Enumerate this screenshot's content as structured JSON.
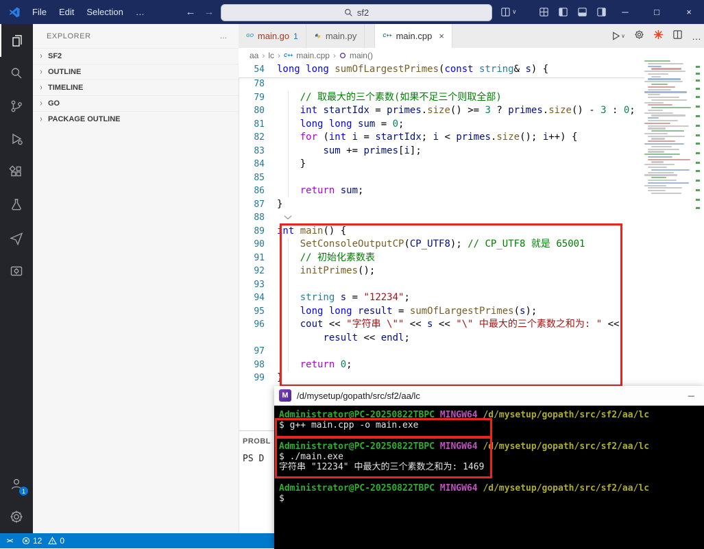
{
  "titlebar": {
    "menus": [
      "File",
      "Edit",
      "Selection",
      "…"
    ],
    "search_value": "sf2"
  },
  "sidebar": {
    "header": "EXPLORER",
    "sections": [
      "SF2",
      "OUTLINE",
      "TIMELINE",
      "GO",
      "PACKAGE OUTLINE"
    ]
  },
  "tabs": [
    {
      "label": "main.go",
      "badge": "1"
    },
    {
      "label": "main.py",
      "badge": ""
    },
    {
      "label": "main.cpp",
      "badge": ""
    }
  ],
  "breadcrumb": [
    "aa",
    "lc",
    "main.cpp",
    "main()"
  ],
  "editor": {
    "sticky": {
      "num": "54",
      "tokens": [
        [
          "kw",
          "long long "
        ],
        [
          "fn",
          "sumOfLargestPrimes"
        ],
        [
          "op",
          "("
        ],
        [
          "kw",
          "const "
        ],
        [
          "type",
          "string"
        ],
        [
          "op",
          "& "
        ],
        [
          "var",
          "s"
        ],
        [
          "op",
          ") {"
        ]
      ]
    },
    "lines": [
      {
        "num": "78",
        "tokens": []
      },
      {
        "num": "79",
        "tokens": [
          [
            "op",
            "    "
          ],
          [
            "cmt",
            "// 取最大的三个素数(如果不足三个则取全部)"
          ]
        ]
      },
      {
        "num": "80",
        "tokens": [
          [
            "op",
            "    "
          ],
          [
            "kw",
            "int "
          ],
          [
            "var",
            "startIdx"
          ],
          [
            "op",
            " = "
          ],
          [
            "var",
            "primes"
          ],
          [
            "op",
            "."
          ],
          [
            "fn",
            "size"
          ],
          [
            "op",
            "() >= "
          ],
          [
            "num",
            "3"
          ],
          [
            "op",
            " ? "
          ],
          [
            "var",
            "primes"
          ],
          [
            "op",
            "."
          ],
          [
            "fn",
            "size"
          ],
          [
            "op",
            "() - "
          ],
          [
            "num",
            "3"
          ],
          [
            "op",
            " : "
          ],
          [
            "num",
            "0"
          ],
          [
            "op",
            ";"
          ]
        ]
      },
      {
        "num": "81",
        "tokens": [
          [
            "op",
            "    "
          ],
          [
            "kw",
            "long long "
          ],
          [
            "var",
            "sum"
          ],
          [
            "op",
            " = "
          ],
          [
            "num",
            "0"
          ],
          [
            "op",
            ";"
          ]
        ]
      },
      {
        "num": "82",
        "tokens": [
          [
            "op",
            "    "
          ],
          [
            "ctrl",
            "for"
          ],
          [
            "op",
            " ("
          ],
          [
            "kw",
            "int "
          ],
          [
            "var",
            "i"
          ],
          [
            "op",
            " = "
          ],
          [
            "var",
            "startIdx"
          ],
          [
            "op",
            "; "
          ],
          [
            "var",
            "i"
          ],
          [
            "op",
            " < "
          ],
          [
            "var",
            "primes"
          ],
          [
            "op",
            "."
          ],
          [
            "fn",
            "size"
          ],
          [
            "op",
            "(); "
          ],
          [
            "var",
            "i"
          ],
          [
            "op",
            "++) {"
          ]
        ]
      },
      {
        "num": "83",
        "tokens": [
          [
            "op",
            "        "
          ],
          [
            "var",
            "sum"
          ],
          [
            "op",
            " += "
          ],
          [
            "var",
            "primes"
          ],
          [
            "op",
            "["
          ],
          [
            "var",
            "i"
          ],
          [
            "op",
            "];"
          ]
        ]
      },
      {
        "num": "84",
        "tokens": [
          [
            "op",
            "    }"
          ]
        ]
      },
      {
        "num": "85",
        "tokens": []
      },
      {
        "num": "86",
        "tokens": [
          [
            "op",
            "    "
          ],
          [
            "ctrl",
            "return"
          ],
          [
            "op",
            " "
          ],
          [
            "var",
            "sum"
          ],
          [
            "op",
            ";"
          ]
        ]
      },
      {
        "num": "87",
        "tokens": [
          [
            "op",
            "}"
          ]
        ]
      },
      {
        "num": "88",
        "tokens": []
      },
      {
        "num": "89",
        "tokens": [
          [
            "kw",
            "int "
          ],
          [
            "fn",
            "main"
          ],
          [
            "op",
            "() {"
          ]
        ]
      },
      {
        "num": "90",
        "tokens": [
          [
            "op",
            "    "
          ],
          [
            "fn",
            "SetConsoleOutputCP"
          ],
          [
            "op",
            "("
          ],
          [
            "var",
            "CP_UTF8"
          ],
          [
            "op",
            "); "
          ],
          [
            "cmt",
            "// CP_UTF8 就是 65001"
          ]
        ]
      },
      {
        "num": "91",
        "tokens": [
          [
            "op",
            "    "
          ],
          [
            "cmt",
            "// 初始化素数表"
          ]
        ]
      },
      {
        "num": "92",
        "tokens": [
          [
            "op",
            "    "
          ],
          [
            "fn",
            "initPrimes"
          ],
          [
            "op",
            "();"
          ]
        ]
      },
      {
        "num": "93",
        "tokens": []
      },
      {
        "num": "94",
        "tokens": [
          [
            "op",
            "    "
          ],
          [
            "type",
            "string"
          ],
          [
            "op",
            " "
          ],
          [
            "var",
            "s"
          ],
          [
            "op",
            " = "
          ],
          [
            "str",
            "\"12234\""
          ],
          [
            "op",
            ";"
          ]
        ]
      },
      {
        "num": "95",
        "tokens": [
          [
            "op",
            "    "
          ],
          [
            "kw",
            "long long "
          ],
          [
            "var",
            "result"
          ],
          [
            "op",
            " = "
          ],
          [
            "fn",
            "sumOfLargestPrimes"
          ],
          [
            "op",
            "("
          ],
          [
            "var",
            "s"
          ],
          [
            "op",
            ");"
          ]
        ]
      },
      {
        "num": "96",
        "tokens": [
          [
            "op",
            "    "
          ],
          [
            "var",
            "cout"
          ],
          [
            "op",
            " << "
          ],
          [
            "str",
            "\"字符串 \\\"\""
          ],
          [
            "op",
            " << "
          ],
          [
            "var",
            "s"
          ],
          [
            "op",
            " << "
          ],
          [
            "str",
            "\"\\\" 中最大的三个素数之和为: \""
          ],
          [
            "op",
            " <<"
          ]
        ]
      },
      {
        "num": "",
        "tokens": [
          [
            "op",
            "        "
          ],
          [
            "var",
            "result"
          ],
          [
            "op",
            " << "
          ],
          [
            "var",
            "endl"
          ],
          [
            "op",
            ";"
          ]
        ]
      },
      {
        "num": "97",
        "tokens": []
      },
      {
        "num": "98",
        "tokens": [
          [
            "op",
            "    "
          ],
          [
            "ctrl",
            "return"
          ],
          [
            "op",
            " "
          ],
          [
            "num",
            "0"
          ],
          [
            "op",
            ";"
          ]
        ]
      },
      {
        "num": "99",
        "tokens": [
          [
            "op",
            "}"
          ]
        ]
      }
    ]
  },
  "panel": {
    "tab": "PROBL",
    "content": "PS D"
  },
  "terminal": {
    "title": "/d/mysetup/gopath/src/sf2/aa/lc",
    "lines": [
      {
        "parts": [
          [
            "green",
            "Administrator@PC-20250822TBPC "
          ],
          [
            "magenta",
            "MINGW64 "
          ],
          [
            "yellow",
            "/d/mysetup/gopath/src/sf2/aa/lc"
          ]
        ]
      },
      {
        "parts": [
          [
            "white",
            "$ g++ main.cpp -o main.exe"
          ]
        ]
      },
      {
        "parts": []
      },
      {
        "parts": [
          [
            "green",
            "Administrator@PC-20250822TBPC "
          ],
          [
            "magenta",
            "MINGW64 "
          ],
          [
            "yellow",
            "/d/mysetup/gopath/src/sf2/aa/lc"
          ]
        ]
      },
      {
        "parts": [
          [
            "white",
            "$ ./main.exe"
          ]
        ]
      },
      {
        "parts": [
          [
            "white",
            "字符串 \"12234\" 中最大的三个素数之和为: 1469"
          ]
        ]
      },
      {
        "parts": []
      },
      {
        "parts": [
          [
            "green",
            "Administrator@PC-20250822TBPC "
          ],
          [
            "magenta",
            "MINGW64 "
          ],
          [
            "yellow",
            "/d/mysetup/gopath/src/sf2/aa/lc"
          ]
        ]
      },
      {
        "parts": [
          [
            "white",
            "$"
          ]
        ]
      }
    ]
  },
  "statusbar": {
    "errors": "12",
    "warnings": "0"
  },
  "colors": {
    "syntax": {
      "kw": "#0000ff",
      "ctrl": "#af00db",
      "type": "#267f99",
      "fn": "#795e26",
      "str": "#a31515",
      "num": "#098658",
      "cmt": "#008000",
      "var": "#001080",
      "op": "#000000"
    },
    "terminal": {
      "green": "#2eaf2e",
      "magenta": "#c050c0",
      "yellow": "#aeae2a",
      "white": "#e4e4e4"
    },
    "ui": {
      "titlebar": "#1c2b5e",
      "statusbar": "#007acc",
      "annotation": "#e8251f",
      "tab_modified_label": "#9c3a20",
      "tab_badge": "#1f6fbf"
    }
  }
}
